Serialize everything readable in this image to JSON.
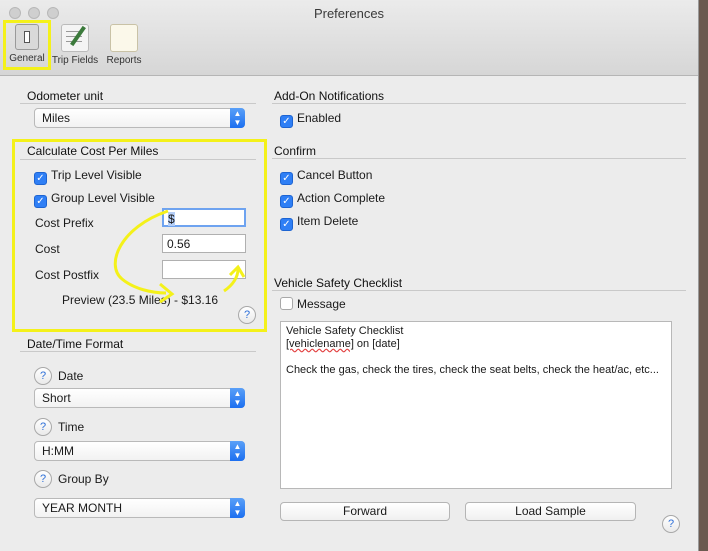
{
  "window": {
    "title": "Preferences"
  },
  "toolbar": {
    "general_label": "General",
    "trip_fields_label": "Trip Fields",
    "reports_label": "Reports"
  },
  "odometer": {
    "section_label": "Odometer unit",
    "selected": "Miles"
  },
  "cost": {
    "section_label": "Calculate Cost Per Miles",
    "trip_level_label": "Trip Level Visible",
    "trip_level_checked": true,
    "group_level_label": "Group Level Visible",
    "group_level_checked": true,
    "prefix_label": "Cost Prefix",
    "prefix_value": "$",
    "cost_label": "Cost",
    "cost_value": "0.56",
    "postfix_label": "Cost Postfix",
    "postfix_value": "",
    "preview": "Preview (23.5 Miles) - $13.16",
    "help_glyph": "?"
  },
  "datetime": {
    "section_label": "Date/Time Format",
    "date_label": "Date",
    "date_selected": "Short",
    "time_label": "Time",
    "time_selected": "H:MM",
    "groupby_label": "Group By",
    "groupby_selected": "YEAR MONTH",
    "help_glyph": "?"
  },
  "addon": {
    "section_label": "Add-On Notifications",
    "enabled_label": "Enabled",
    "enabled_checked": true
  },
  "confirm": {
    "section_label": "Confirm",
    "cancel_label": "Cancel Button",
    "action_label": "Action Complete",
    "item_delete_label": "Item Delete"
  },
  "vehicle": {
    "section_label": "Vehicle Safety Checklist",
    "message_label": "Message",
    "message_checked": false,
    "text_line1": "Vehicle Safety Checklist",
    "text_token": "[vehiclename]",
    "text_line2_rest": " on [date]",
    "text_line3": "Check the gas, check the tires, check the seat belts, check the heat/ac, etc...",
    "forward_label": "Forward",
    "load_sample_label": "Load Sample",
    "help_glyph": "?"
  },
  "colors": {
    "annotation_yellow": "#f4f11a",
    "checkbox_blue": "#2f7ff5"
  }
}
